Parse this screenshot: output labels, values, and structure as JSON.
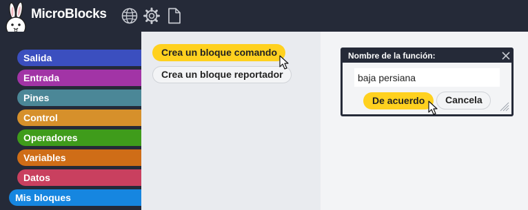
{
  "app": {
    "title": "MicroBlocks"
  },
  "topbar": {
    "icons": [
      {
        "name": "globe-icon"
      },
      {
        "name": "gear-icon"
      },
      {
        "name": "file-icon"
      }
    ]
  },
  "sidebar": {
    "categories": [
      {
        "label": "Salida",
        "color": "#3b4fbf"
      },
      {
        "label": "Entrada",
        "color": "#a234a6"
      },
      {
        "label": "Pines",
        "color": "#4b8797"
      },
      {
        "label": "Control",
        "color": "#d6902b"
      },
      {
        "label": "Operadores",
        "color": "#3f9c1b"
      },
      {
        "label": "Variables",
        "color": "#cf6d17"
      },
      {
        "label": "Datos",
        "color": "#c9405f"
      },
      {
        "label": "Mis bloques",
        "color": "#1686e0"
      }
    ]
  },
  "palette": {
    "make_command": "Crea un bloque comando",
    "make_reporter": "Crea un bloque reportador"
  },
  "dialog": {
    "title": "Nombre de la función:",
    "input_value": "baja persiana",
    "ok": "De acuerdo",
    "cancel": "Cancela"
  },
  "colors": {
    "topbar_bg": "#252a38",
    "accent_yellow": "#ffd11f"
  }
}
